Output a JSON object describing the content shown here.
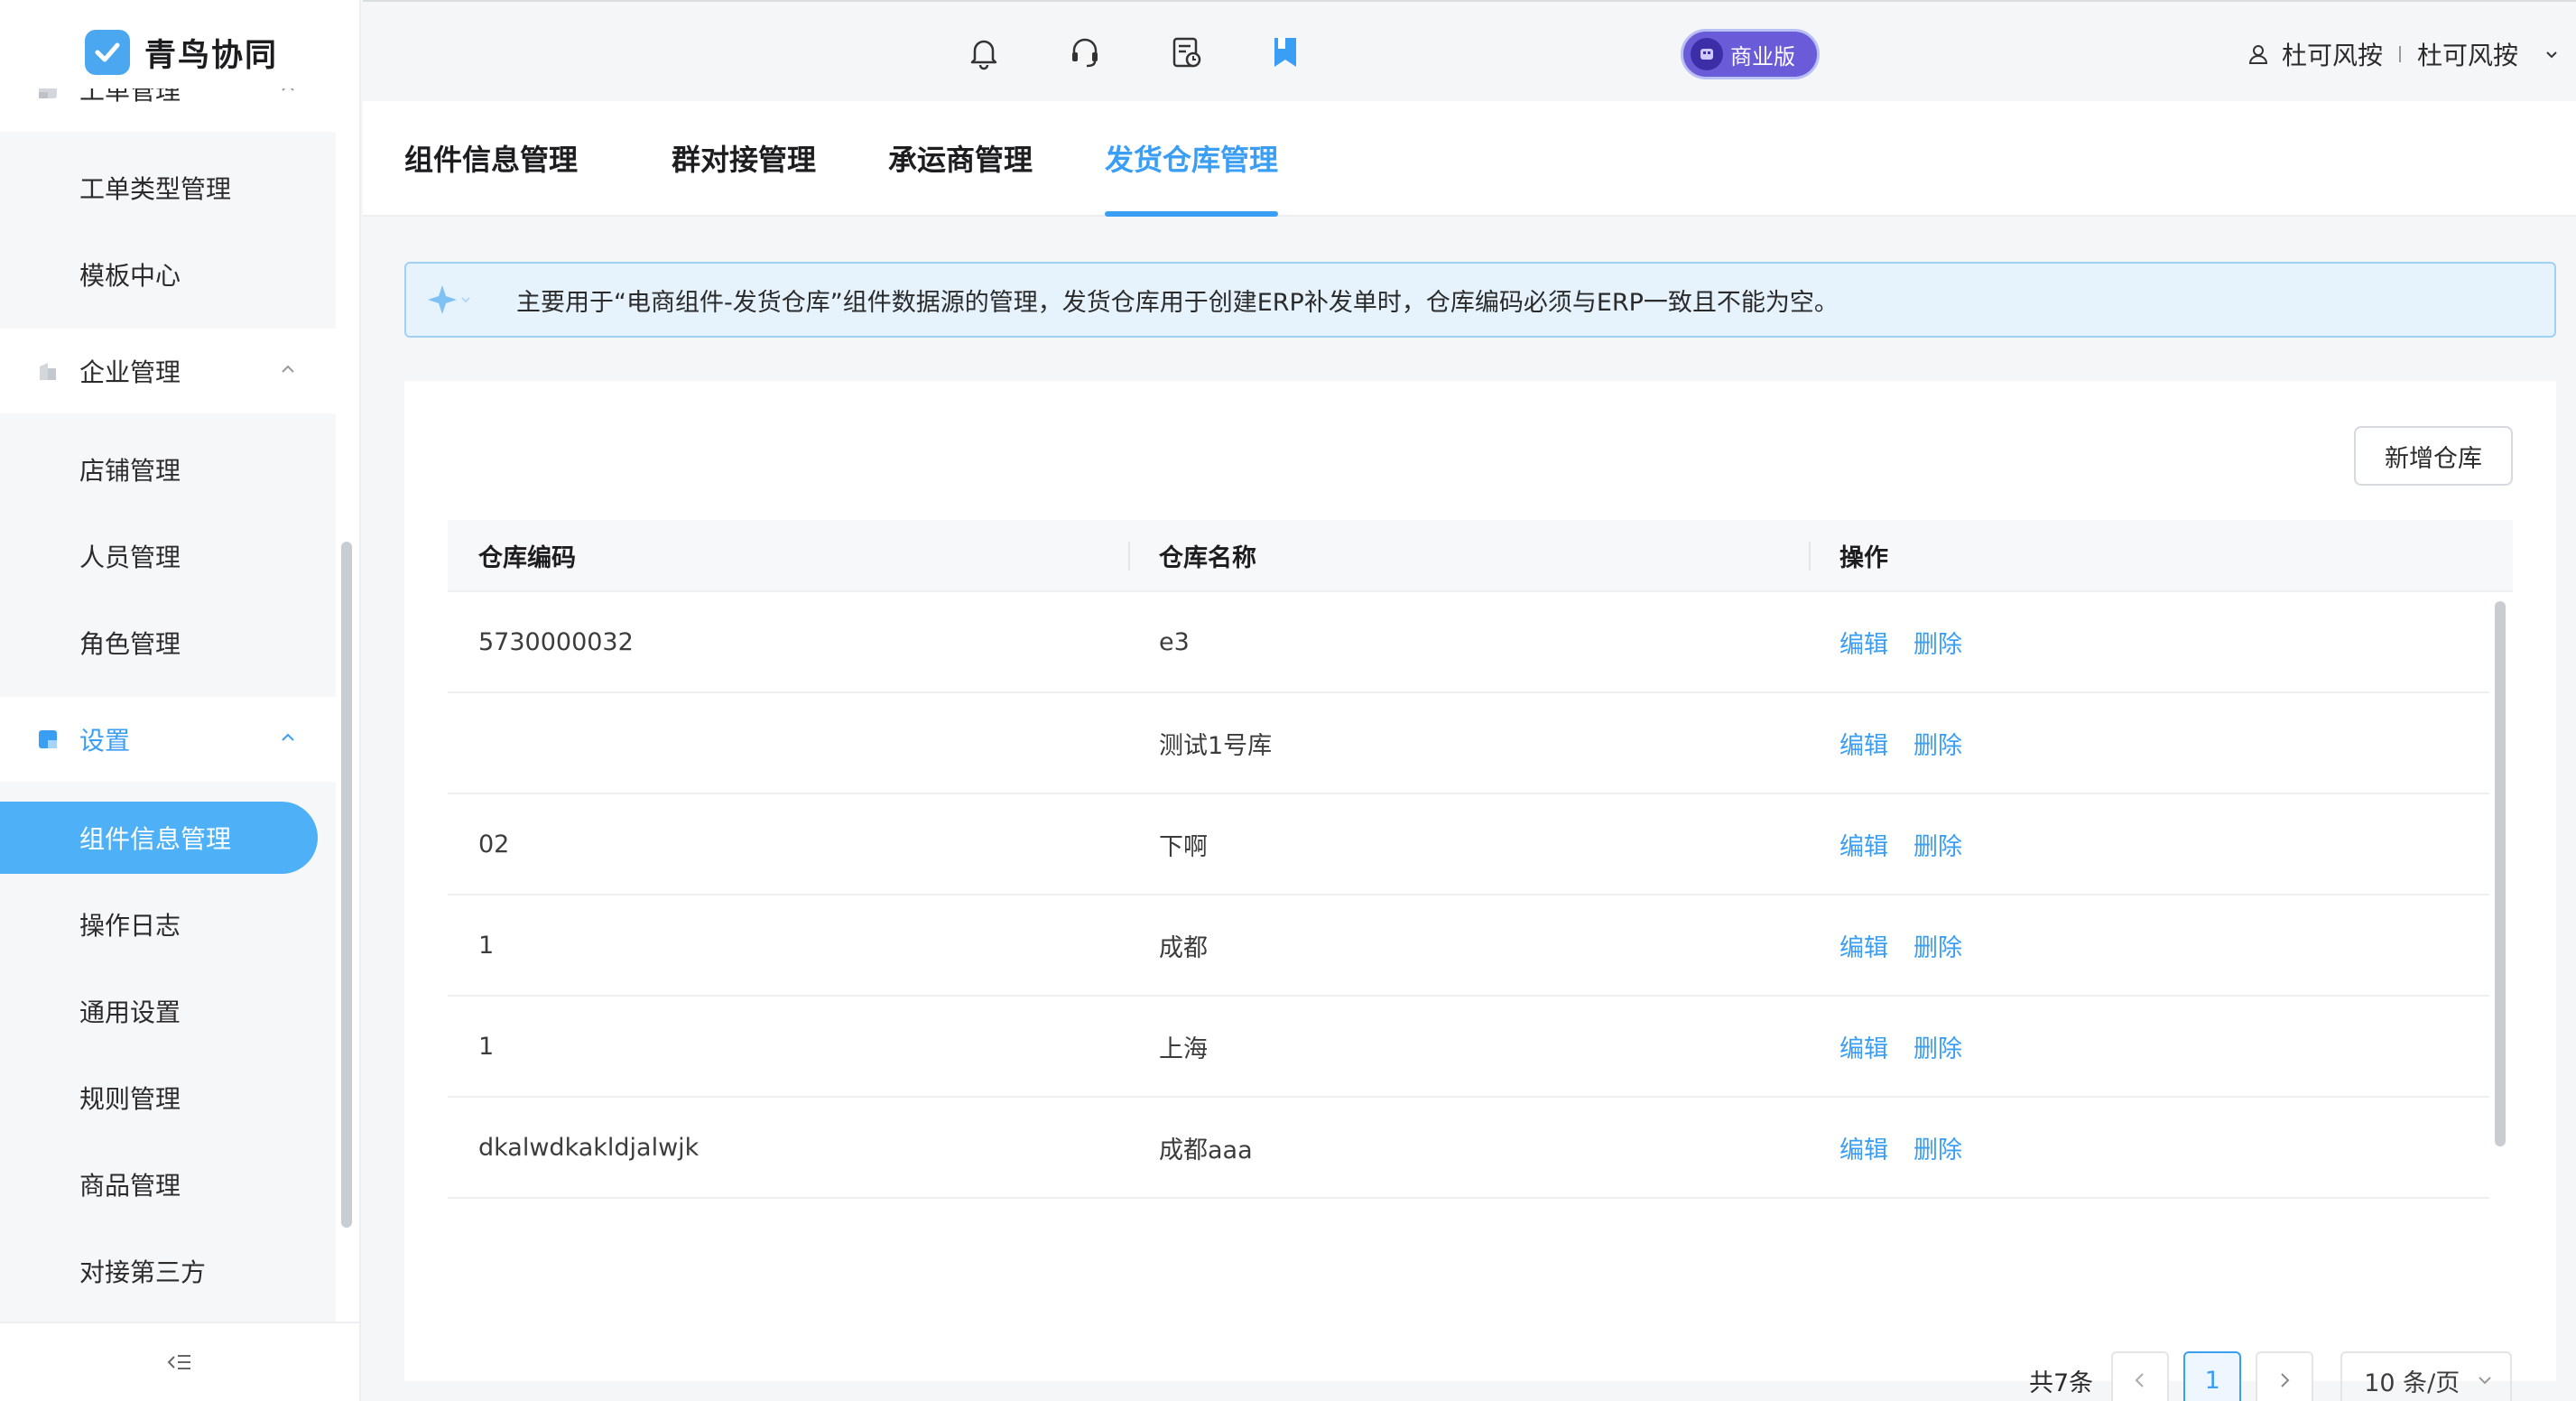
{
  "app": {
    "name": "青鸟协同"
  },
  "sidebar": {
    "groups": [
      {
        "label": "工单管理",
        "items": [
          "工单类型管理",
          "模板中心"
        ]
      },
      {
        "label": "企业管理",
        "items": [
          "店铺管理",
          "人员管理",
          "角色管理"
        ]
      },
      {
        "label": "设置",
        "active": true,
        "items": [
          "组件信息管理",
          "操作日志",
          "通用设置",
          "规则管理",
          "商品管理",
          "对接第三方"
        ]
      }
    ],
    "active_item": "组件信息管理"
  },
  "topbar": {
    "plan_badge": "商业版",
    "icons": [
      "bell-icon",
      "headset-icon",
      "report-icon",
      "bookmark-icon"
    ],
    "user_name": "杜可风按",
    "org_name": "杜可风按"
  },
  "tabs": [
    {
      "label": "组件信息管理",
      "active": false
    },
    {
      "label": "群对接管理",
      "active": false
    },
    {
      "label": "承运商管理",
      "active": false
    },
    {
      "label": "发货仓库管理",
      "active": true
    }
  ],
  "notice": {
    "text": "主要用于“电商组件-发货仓库”组件数据源的管理，发货仓库用于创建ERP补发单时，仓库编码必须与ERP一致且不能为空。"
  },
  "toolbar": {
    "add_label": "新增仓库"
  },
  "table": {
    "columns": [
      "仓库编码",
      "仓库名称",
      "操作"
    ],
    "rows": [
      {
        "code": "5730000032",
        "name": "e3"
      },
      {
        "code": "",
        "name": "测试1号库"
      },
      {
        "code": "02",
        "name": "下啊"
      },
      {
        "code": "1",
        "name": "成都"
      },
      {
        "code": "1",
        "name": "上海"
      },
      {
        "code": "dkalwdkakldjalwjk",
        "name": "成都aaa"
      }
    ],
    "actions": {
      "edit": "编辑",
      "delete": "删除"
    }
  },
  "pagination": {
    "total_text": "共7条",
    "current_page": "1",
    "page_size": "10 条/页"
  },
  "colors": {
    "accent": "#3a9ef5",
    "active_menu_bg": "#4eb0f7",
    "badge": "#6a5bd8"
  }
}
